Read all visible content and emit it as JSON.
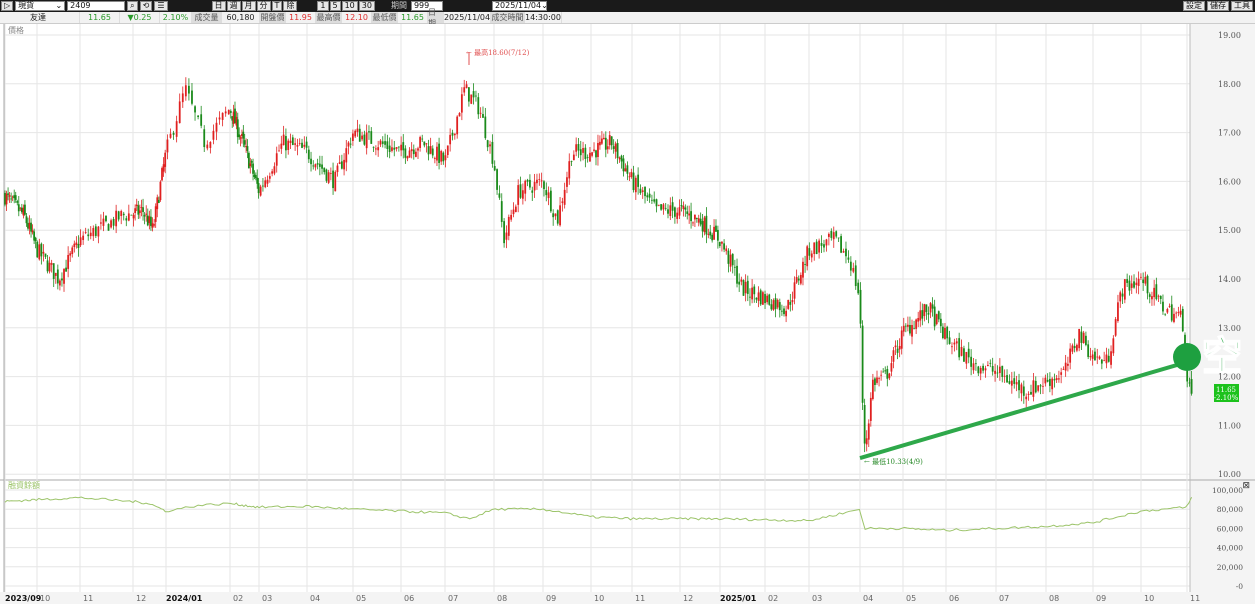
{
  "toolbar": {
    "market": "現貨",
    "symbol": "2409",
    "period_label": "期間",
    "period_value": "999",
    "date": "2025/11/04",
    "freq_buttons": [
      "日",
      "週",
      "月",
      "分",
      "T",
      "除"
    ],
    "minute_buttons": [
      "1",
      "5",
      "10",
      "30"
    ],
    "right_buttons": [
      "設定",
      "儲存",
      "工具"
    ]
  },
  "info": {
    "name": "友達",
    "price": "11.65",
    "change": "▼0.25",
    "change_pct": "2.10%",
    "volume_label": "成交量",
    "volume": "60,180",
    "open_label": "開盤價",
    "open": "11.95",
    "high_label": "最高價",
    "high": "12.10",
    "low_label": "最低價",
    "low": "11.65",
    "date_label": "日期",
    "date": "2025/11/04",
    "time_label": "成交時間",
    "time": "14:30:00"
  },
  "colors": {
    "up": "#e02020",
    "down": "#1a8a1a",
    "trend": "#2ea84a",
    "margin": "#9cc46a"
  },
  "chart_data": {
    "type": "candlestick",
    "price_panel": {
      "title": "價格",
      "ylim": [
        10,
        19
      ],
      "yticks": [
        "19.00",
        "18.00",
        "17.00",
        "16.00",
        "15.00",
        "14.00",
        "13.00",
        "12.00",
        "11.00",
        "10.00"
      ],
      "high_annotation": "最高18.60(7/12)",
      "low_annotation": "最低10.33(4/9)",
      "last_price": "11.65",
      "last_pct": "-2.10%",
      "signal": "空",
      "trendline": [
        [
          19.0,
          10.33
        ],
        [
          26.1,
          12.35
        ]
      ],
      "close_path_month_price": [
        [
          0,
          15.7
        ],
        [
          0.6,
          15.3
        ],
        [
          1,
          14.6
        ],
        [
          1.5,
          14.0
        ],
        [
          2,
          14.8
        ],
        [
          2.8,
          15.3
        ],
        [
          3.3,
          15.4
        ],
        [
          3.6,
          15.0
        ],
        [
          4,
          16.6
        ],
        [
          4.3,
          17.9
        ],
        [
          4.6,
          16.8
        ],
        [
          5,
          17.5
        ],
        [
          5.5,
          16.7
        ],
        [
          6,
          15.8
        ],
        [
          6.5,
          16.8
        ],
        [
          7,
          16.6
        ],
        [
          7.6,
          16.0
        ],
        [
          8,
          17.0
        ],
        [
          8.5,
          16.8
        ],
        [
          9,
          16.6
        ],
        [
          9.5,
          16.8
        ],
        [
          10,
          16.4
        ],
        [
          10.4,
          17.9
        ],
        [
          10.7,
          17.5
        ],
        [
          11,
          16.4
        ],
        [
          11.2,
          14.8
        ],
        [
          11.5,
          15.8
        ],
        [
          12,
          16.0
        ],
        [
          12.3,
          15.2
        ],
        [
          12.6,
          16.6
        ],
        [
          13,
          16.6
        ],
        [
          13.5,
          16.8
        ],
        [
          14,
          16.0
        ],
        [
          14.5,
          15.4
        ],
        [
          15,
          15.4
        ],
        [
          15.5,
          15.2
        ],
        [
          16,
          14.8
        ],
        [
          16.5,
          13.8
        ],
        [
          17,
          13.6
        ],
        [
          17.5,
          13.4
        ],
        [
          18,
          14.6
        ],
        [
          18.5,
          14.8
        ],
        [
          18.8,
          14.4
        ],
        [
          19,
          13.6
        ],
        [
          19.05,
          11.5
        ],
        [
          19.12,
          10.5
        ],
        [
          19.3,
          11.9
        ],
        [
          19.6,
          12.0
        ],
        [
          20,
          12.9
        ],
        [
          20.6,
          13.4
        ],
        [
          21,
          12.8
        ],
        [
          21.5,
          12.3
        ],
        [
          22,
          12.1
        ],
        [
          22.6,
          11.7
        ],
        [
          23,
          11.9
        ],
        [
          23.4,
          12.1
        ],
        [
          23.7,
          12.9
        ],
        [
          24,
          12.4
        ],
        [
          24.3,
          12.3
        ],
        [
          24.6,
          13.8
        ],
        [
          25,
          14.0
        ],
        [
          25.5,
          13.4
        ],
        [
          25.9,
          13.2
        ],
        [
          26,
          11.9
        ],
        [
          26.1,
          11.65
        ]
      ]
    },
    "margin_panel": {
      "title": "融資餘額",
      "ylim": [
        0,
        100000
      ],
      "yticks": [
        "100,000",
        "80,000",
        "60,000",
        "40,000",
        "20,000",
        "-0"
      ],
      "series_month_value": [
        [
          0,
          88000
        ],
        [
          2,
          92000
        ],
        [
          3.5,
          86000
        ],
        [
          4,
          78000
        ],
        [
          4.5,
          84000
        ],
        [
          5,
          86000
        ],
        [
          6,
          82000
        ],
        [
          7,
          83000
        ],
        [
          8,
          80000
        ],
        [
          9,
          78000
        ],
        [
          10,
          76000
        ],
        [
          10.5,
          70000
        ],
        [
          11,
          80000
        ],
        [
          12,
          80000
        ],
        [
          13,
          72000
        ],
        [
          14,
          70000
        ],
        [
          16,
          70000
        ],
        [
          18,
          68000
        ],
        [
          19,
          80000
        ],
        [
          19.1,
          60000
        ],
        [
          20,
          60000
        ],
        [
          21,
          58000
        ],
        [
          22,
          60000
        ],
        [
          23,
          62000
        ],
        [
          24,
          66000
        ],
        [
          25,
          78000
        ],
        [
          26,
          82000
        ],
        [
          26.1,
          92000
        ]
      ]
    },
    "x_labels": [
      "2023/09",
      "10",
      "11",
      "12",
      "2024/01",
      "02",
      "03",
      "04",
      "05",
      "06",
      "07",
      "08",
      "09",
      "10",
      "11",
      "12",
      "2025/01",
      "02",
      "03",
      "04",
      "05",
      "06",
      "07",
      "08",
      "09",
      "10",
      "11"
    ]
  }
}
